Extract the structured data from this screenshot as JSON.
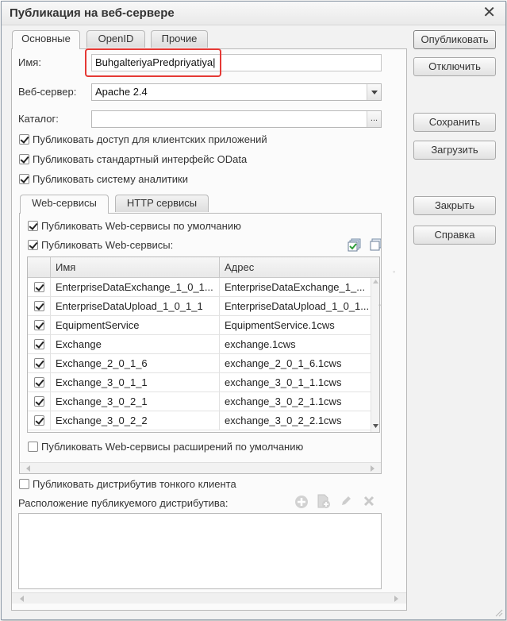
{
  "window": {
    "title": "Публикация на веб-сервере"
  },
  "tabs": [
    "Основные",
    "OpenID",
    "Прочие"
  ],
  "form": {
    "name_label": "Имя:",
    "name_value": "BuhgalteriyaPredpriyatiya",
    "webserver_label": "Веб-сервер:",
    "webserver_value": "Apache 2.4",
    "catalog_label": "Каталог:",
    "catalog_value": "",
    "catalog_button": "...",
    "publish_clients": "Публиковать доступ для клиентских приложений",
    "publish_odata": "Публиковать стандартный интерфейс OData",
    "publish_analytics": "Публиковать систему аналитики"
  },
  "inner_tabs": [
    "Web-сервисы",
    "HTTP сервисы"
  ],
  "webservices": {
    "publish_default": "Публиковать Web-сервисы по умолчанию",
    "publish_ws": "Публиковать Web-сервисы:",
    "columns": [
      "Имя",
      "Адрес"
    ],
    "rows": [
      {
        "name": "EnterpriseDataExchange_1_0_1...",
        "address": "EnterpriseDataExchange_1_..."
      },
      {
        "name": "EnterpriseDataUpload_1_0_1_1",
        "address": "EnterpriseDataUpload_1_0_1..."
      },
      {
        "name": "EquipmentService",
        "address": "EquipmentService.1cws"
      },
      {
        "name": "Exchange",
        "address": "exchange.1cws"
      },
      {
        "name": "Exchange_2_0_1_6",
        "address": "exchange_2_0_1_6.1cws"
      },
      {
        "name": "Exchange_3_0_1_1",
        "address": "exchange_3_0_1_1.1cws"
      },
      {
        "name": "Exchange_3_0_2_1",
        "address": "exchange_3_0_2_1.1cws"
      },
      {
        "name": "Exchange_3_0_2_2",
        "address": "exchange_3_0_2_2.1cws"
      }
    ],
    "publish_extensions": "Публиковать Web-сервисы расширений по умолчанию"
  },
  "distrib": {
    "publish_thin": "Публиковать дистрибутив тонкого клиента",
    "location_label": "Расположение публикуемого дистрибутива:"
  },
  "buttons": {
    "publish": "Опубликовать",
    "disable": "Отключить",
    "save": "Сохранить",
    "load": "Загрузить",
    "close": "Закрыть",
    "help": "Справка"
  },
  "colors": {
    "highlight": "#e53935"
  }
}
